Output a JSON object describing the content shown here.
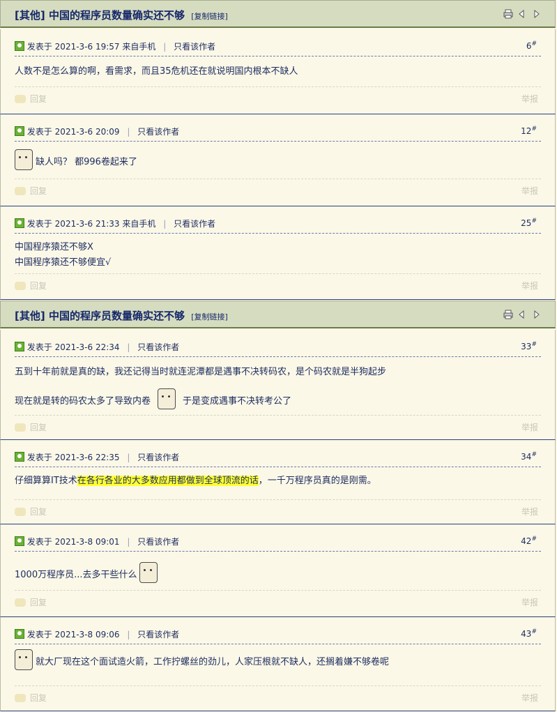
{
  "threads": [
    {
      "tag": "[其他]",
      "title": "中国的程序员数量确实还不够",
      "copy_link": "[复制链接]"
    },
    {
      "tag": "[其他]",
      "title": "中国的程序员数量确实还不够",
      "copy_link": "[复制链接]"
    }
  ],
  "common": {
    "posted_prefix": "发表于",
    "only_author": "只看该作者",
    "reply": "回复",
    "report": "举报"
  },
  "posts": [
    {
      "time": "2021-3-6 19:57",
      "source": "来自手机",
      "floor": "6",
      "lines": [
        "人数不是怎么算的啊，看需求，而且35危机还在就说明国内根本不缺人"
      ]
    },
    {
      "time": "2021-3-6 20:09",
      "source": "",
      "floor": "12",
      "lines": [
        "缺人吗？ 都996卷起来了"
      ]
    },
    {
      "time": "2021-3-6 21:33",
      "source": "来自手机",
      "floor": "25",
      "lines": [
        "中国程序猿还不够X",
        "中国程序猿还不够便宜√"
      ]
    },
    {
      "time": "2021-3-6 22:34",
      "source": "",
      "floor": "33",
      "lines": [
        "五到十年前就是真的缺，我还记得当时就连泥潭都是遇事不决转码农，是个码农就是半狗起步",
        "现在就是转的码农太多了导致内卷",
        "于是变成遇事不决转考公了"
      ]
    },
    {
      "time": "2021-3-6 22:35",
      "source": "",
      "floor": "34",
      "lines": [
        "仔细算算IT技术",
        "在各行各业的大多数应用都做到全球顶流的话",
        "，一千万程序员真的是刚需。"
      ]
    },
    {
      "time": "2021-3-8 09:01",
      "source": "",
      "floor": "42",
      "lines": [
        "1000万程序员...去多干些什么"
      ]
    },
    {
      "time": "2021-3-8 09:06",
      "source": "",
      "floor": "43",
      "lines": [
        "就大厂现在这个面试造火箭，工作拧螺丝的劲儿，人家压根就不缺人，还搁着嫌不够卷呢"
      ]
    }
  ]
}
